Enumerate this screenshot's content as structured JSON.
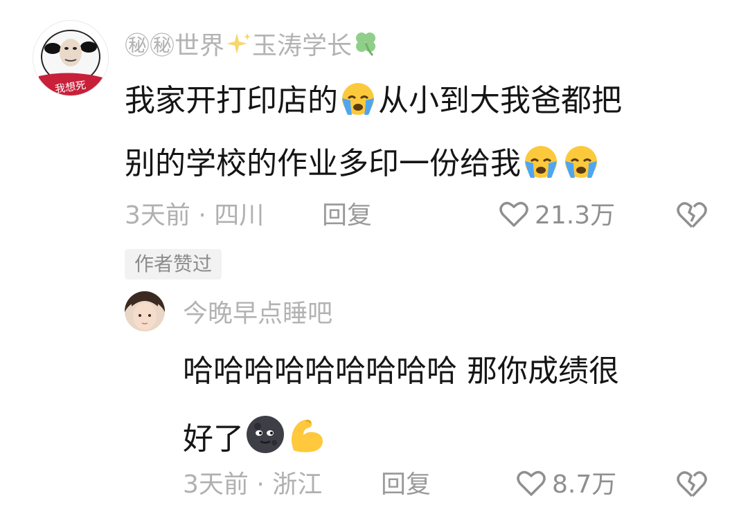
{
  "comment": {
    "username_prefix": "㊙㊙世界",
    "username_suffix": "玉涛学长",
    "avatar_caption": "我想死",
    "text_line1_a": "我家开打印店的",
    "text_line1_b": "从小到大我爸都把",
    "text_line2": "别的学校的作业多印一份给我",
    "time_location": "3天前 · 四川",
    "reply_label": "回复",
    "like_count": "21.3万",
    "author_liked_label": "作者赞过"
  },
  "reply": {
    "username": "今晚早点睡吧",
    "text_line1": "哈哈哈哈哈哈哈哈哈 那你成绩很",
    "text_line2": "好了",
    "time_location": "3天前 · 浙江",
    "reply_label": "回复",
    "like_count": "8.7万"
  },
  "icons": {
    "like": "heart-outline-icon",
    "dislike": "broken-heart-icon",
    "crying": "loudly-crying-face-emoji",
    "moon": "new-moon-face-emoji",
    "muscle": "flexed-biceps-emoji",
    "sparkles": "sparkles-emoji",
    "clover": "four-leaf-clover-emoji"
  },
  "colors": {
    "meta_gray": "#b0b0b0",
    "text_dark": "#151515",
    "tag_bg": "#f2f2f2"
  }
}
